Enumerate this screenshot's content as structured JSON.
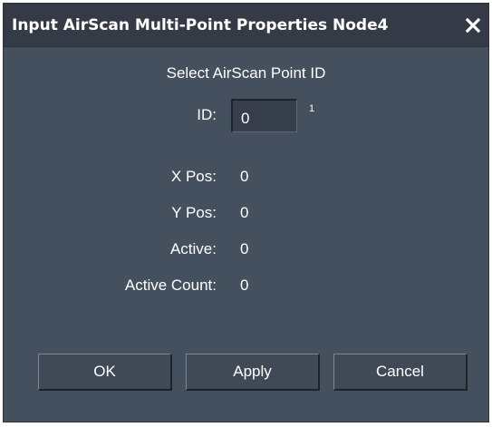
{
  "window": {
    "title": "Input AirScan Multi-Point Properties Node4",
    "close_icon": "close-icon"
  },
  "main": {
    "subtitle": "Select AirScan Point ID",
    "id_label": "ID:",
    "id_value": "0",
    "id_superscript": "1",
    "fields": [
      {
        "label": "X Pos:",
        "value": "0"
      },
      {
        "label": "Y Pos:",
        "value": "0"
      },
      {
        "label": "Active:",
        "value": "0"
      },
      {
        "label": "Active Count:",
        "value": "0"
      }
    ]
  },
  "buttons": {
    "ok": "OK",
    "apply": "Apply",
    "cancel": "Cancel"
  },
  "colors": {
    "dialog_bg": "#45505f",
    "titlebar_bg": "#353b46",
    "text": "#ffffff"
  }
}
